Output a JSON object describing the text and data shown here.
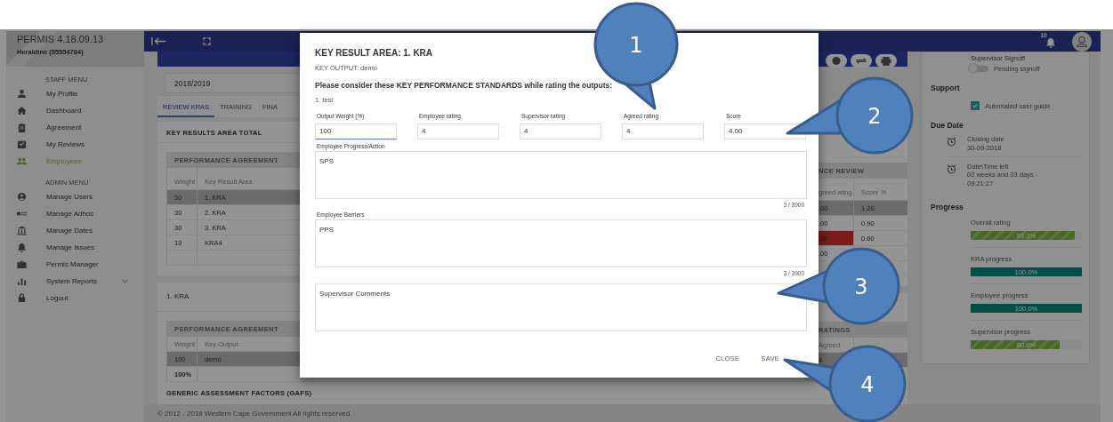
{
  "sidebar": {
    "app_title": "PERMIS 4.18.09.13",
    "user": "Heraldine (55554784)",
    "sections": [
      {
        "heading": "STAFF MENU",
        "items": [
          {
            "label": "My Profile",
            "selected": false,
            "kind": "link"
          },
          {
            "label": "Dashboard",
            "selected": false,
            "kind": "link"
          },
          {
            "label": "Agreement",
            "selected": false,
            "kind": "link"
          },
          {
            "label": "My Reviews",
            "selected": false,
            "kind": "link"
          },
          {
            "label": "Employees",
            "selected": true,
            "kind": "link"
          }
        ]
      },
      {
        "heading": "ADMIN MENU",
        "items": [
          {
            "label": "Manage Users",
            "selected": false,
            "kind": "link"
          },
          {
            "label": "Manage Adhoc",
            "selected": false,
            "kind": "link"
          },
          {
            "label": "Manage Dates",
            "selected": false,
            "kind": "link"
          },
          {
            "label": "Manage Issues",
            "selected": false,
            "kind": "link"
          },
          {
            "label": "Permis Manager",
            "selected": false,
            "kind": "link"
          },
          {
            "label": "System Reports",
            "selected": false,
            "kind": "submenu"
          },
          {
            "label": "Logout",
            "selected": false,
            "kind": "link"
          }
        ]
      }
    ]
  },
  "top_bar": {
    "notification_count": "10"
  },
  "period_select": {
    "value": "2018/2019"
  },
  "tabs": [
    {
      "label": "REVIEW KRAS",
      "selected": true
    },
    {
      "label": "TRAINING",
      "selected": false
    },
    {
      "label": "FINA",
      "selected": false
    }
  ],
  "kra_total": {
    "title": "KEY RESULTS AREA TOTAL",
    "agreement_header": "PERFORMANCE AGREEMENT",
    "review_header": "NCE REVIEW",
    "columns": [
      "Weight",
      "Key Result Area",
      "greed ating",
      "Score %"
    ],
    "rows": [
      {
        "weight": "30",
        "area": "1. KRA",
        "agreed": ".00",
        "score": "1.20",
        "selected": true,
        "flagged": false
      },
      {
        "weight": "30",
        "area": "2. KRA",
        "agreed": ".00",
        "score": "0.90",
        "selected": false,
        "flagged": false
      },
      {
        "weight": "30",
        "area": "3. KRA",
        "agreed": ".00",
        "score": "0.60",
        "selected": false,
        "flagged": true
      },
      {
        "weight": "10",
        "area": "KRA4",
        "agreed": ".00",
        "selected": false,
        "flagged": false
      }
    ]
  },
  "kra_detail": {
    "title": "1. KRA",
    "agreement_header": "PERFORMANCE AGREEMENT",
    "ratings_header": "RATINGS",
    "columns": [
      "Weight",
      "Key Output",
      "Agreed"
    ],
    "rows": [
      {
        "weight": "100",
        "output": "demo",
        "agreed": "4",
        "selected": true
      }
    ],
    "total": "100%"
  },
  "gafs_title": "GENERIC ASSESSMENT FACTORS (GAFS)",
  "footer": "© 2012 - 2018 Western Cape Government All rights reserved.",
  "right_panel": {
    "signoff": {
      "title": "Supervisor Signoff",
      "label": "Pending signoff",
      "on": false
    },
    "support": {
      "title": "Support",
      "label": "Automated user guide",
      "checked": true
    },
    "due_date": {
      "title": "Due Date",
      "items": [
        {
          "label": "Closing date",
          "value": "30-09-2018"
        },
        {
          "label": "Date\\Time left",
          "value": "02 weeks and 03 days - 09:21:27"
        }
      ]
    },
    "progress": {
      "title": "Progress",
      "bars": [
        {
          "label": "Overall rating",
          "reading": "93.3%",
          "level": 0.933,
          "kind": "striped"
        },
        {
          "label": "KRA progress",
          "reading": "100.0%",
          "level": 1.0,
          "kind": "solid"
        },
        {
          "label": "Employee progress",
          "reading": "100.0%",
          "level": 1.0,
          "kind": "solid"
        },
        {
          "label": "Supervisor progress",
          "reading": "80.0%",
          "level": 0.8,
          "kind": "striped"
        }
      ]
    }
  },
  "modal": {
    "title": "KEY RESULT AREA: 1. KRA",
    "key_output": "KEY OUTPUT: demo",
    "standards_prompt": "Please consider these KEY PERFORMANCE STANDARDS while rating the outputs:",
    "standards": [
      "1. test"
    ],
    "fields": [
      {
        "label": "Output Weight (%)",
        "value": "100",
        "focused": true
      },
      {
        "label": "Employee rating",
        "value": "4",
        "focused": false
      },
      {
        "label": "Supervisor rating",
        "value": "4",
        "focused": false
      },
      {
        "label": "Agreed rating",
        "value": "4",
        "focused": false
      },
      {
        "label": "Score",
        "value": "4.00",
        "focused": false
      }
    ],
    "text_areas": [
      {
        "label": "Employee Progress/Action",
        "value": "SPS",
        "counter": "3 / 3900"
      },
      {
        "label": "Employee Barriers",
        "value": "PPS",
        "counter": "3 / 3900"
      },
      {
        "placeholder": "Supervisor Comments"
      }
    ],
    "buttons": [
      "CLOSE",
      "SAVE"
    ]
  },
  "callouts": [
    "1",
    "2",
    "3",
    "4"
  ]
}
